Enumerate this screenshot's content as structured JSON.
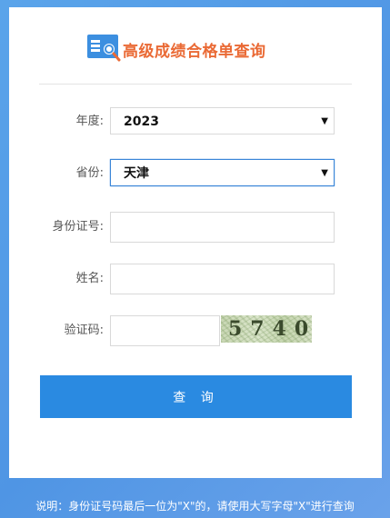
{
  "header": {
    "title": "高级成绩合格单查询",
    "icon": "document-search-icon"
  },
  "form": {
    "year": {
      "label": "年度:",
      "value": "2023"
    },
    "province": {
      "label": "省份:",
      "value": "天津"
    },
    "id_number": {
      "label": "身份证号:",
      "value": ""
    },
    "name": {
      "label": "姓名:",
      "value": ""
    },
    "captcha": {
      "label": "验证码:",
      "value": "",
      "image_text": "5740"
    }
  },
  "actions": {
    "query_label": "查 询"
  },
  "note": "说明：身份证号码最后一位为\"X\"的，请使用大写字母\"X\"进行查询",
  "colors": {
    "accent": "#2a8ae1",
    "title": "#ea6a35",
    "background": "#55a0ea"
  }
}
